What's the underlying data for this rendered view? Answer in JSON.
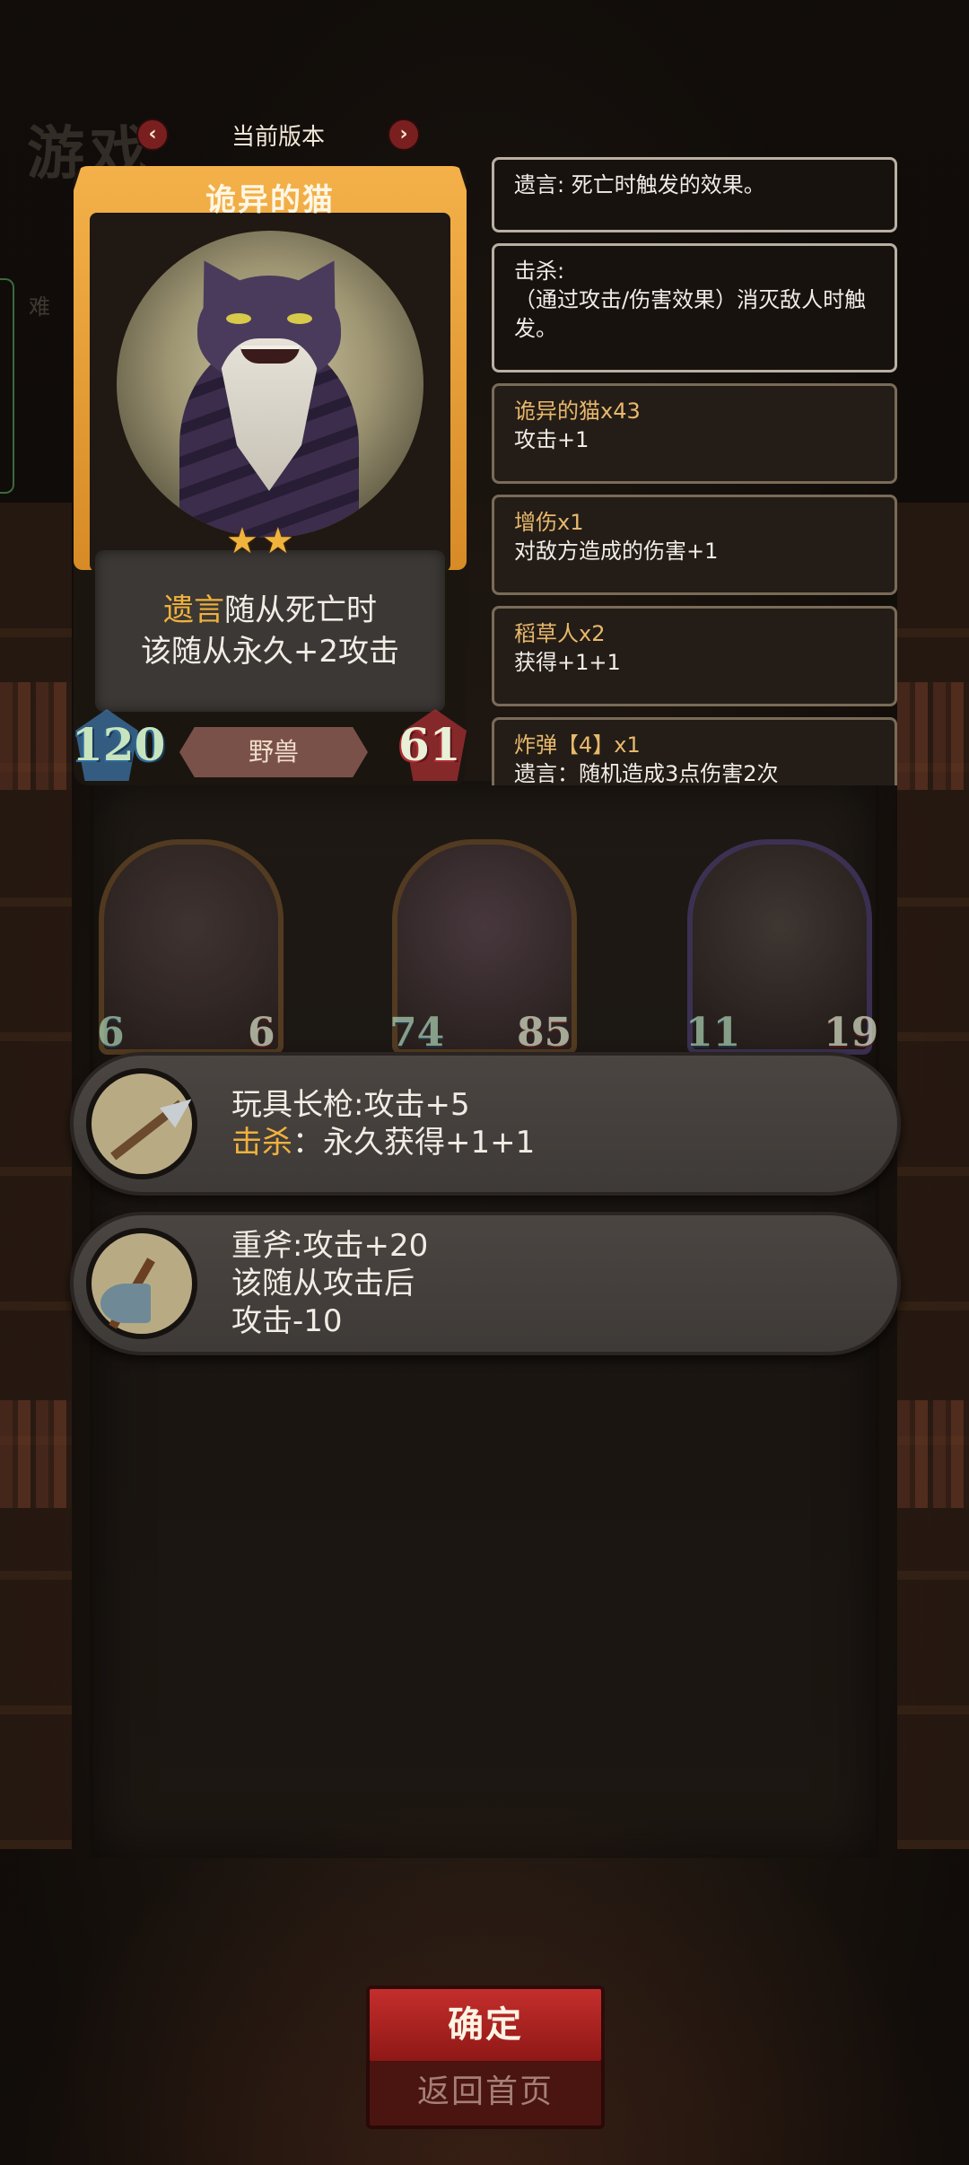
{
  "background": {
    "title_fragment": "游戏",
    "side_text": "难"
  },
  "version_bar": {
    "label": "当前版本",
    "prev": "‹",
    "next": "›"
  },
  "card": {
    "name": "诡异的猫",
    "stars": [
      "★",
      "★"
    ],
    "desc_keyword": "遗言",
    "desc_line1_rest": "随从死亡时",
    "desc_line2": "该随从永久+2攻击",
    "attack": "120",
    "health": "61",
    "tribe": "野兽"
  },
  "keywords": [
    {
      "title": "遗言: 死亡时触发的效果。",
      "body": ""
    },
    {
      "title": "击杀:",
      "body": "（通过攻击/伤害效果）消灭敌人时触发。"
    },
    {
      "title": "诡异的猫x43",
      "body": "攻击+1"
    },
    {
      "title": "增伤x1",
      "body": "对敌方造成的伤害+1"
    },
    {
      "title": "稻草人x2",
      "body": "获得+1+1"
    },
    {
      "title": "炸弹【4】x1",
      "body": "遗言：随机造成3点伤害2次"
    }
  ],
  "minions": [
    {
      "attack": "6",
      "health": "6"
    },
    {
      "attack": "74",
      "health": "85"
    },
    {
      "attack": "11",
      "health": "19"
    }
  ],
  "items": [
    {
      "icon": "spear-icon",
      "line1": "玩具长枪:攻击+5",
      "kw": "击杀",
      "line2_rest": "：永久获得+1+1",
      "line3": ""
    },
    {
      "icon": "axe-icon",
      "line1": "重斧:攻击+20",
      "kw": "",
      "line2_rest": "该随从攻击后",
      "line3": "攻击-10"
    }
  ],
  "buttons": {
    "confirm": "确定",
    "back": "返回首页"
  },
  "colors": {
    "keyword": "#f0b13d",
    "frame": "#e59a33",
    "confirm": "#b02422"
  }
}
